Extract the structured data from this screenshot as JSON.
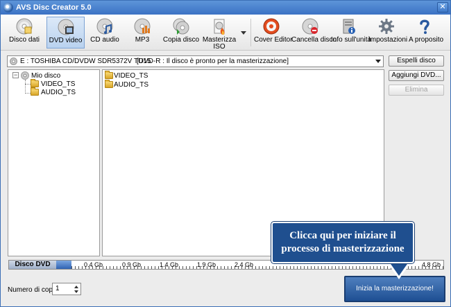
{
  "window": {
    "title": "AVS Disc Creator 5.0",
    "close_glyph": "✕"
  },
  "toolbar": {
    "items": [
      {
        "label": "Disco dati",
        "icon": "data-disc-icon"
      },
      {
        "label": "DVD video",
        "icon": "dvd-video-icon",
        "active": true
      },
      {
        "label": "CD audio",
        "icon": "audio-cd-icon"
      },
      {
        "label": "MP3",
        "icon": "mp3-disc-icon"
      },
      {
        "label": "Copia disco",
        "icon": "copy-disc-icon"
      },
      {
        "label": "Masterizza ISO",
        "icon": "burn-iso-icon"
      },
      {
        "label": "Cover Editor",
        "icon": "cover-editor-icon"
      },
      {
        "label": "Cancella disco",
        "icon": "erase-disc-icon"
      },
      {
        "label": "Info sull'unità",
        "icon": "drive-info-icon"
      },
      {
        "label": "Impostazioni",
        "icon": "settings-gear-icon"
      },
      {
        "label": "A proposito",
        "icon": "help-question-icon"
      }
    ]
  },
  "drive": {
    "name": "E : TOSHIBA  CD/DVDW SDR5372V TU15",
    "status": "[DVD-R : Il disco è pronto per la masterizzazione]"
  },
  "side_buttons": {
    "eject": "Espelli disco",
    "add_dvd": "Aggiungi DVD...",
    "delete": "Elimina"
  },
  "tree": {
    "root": "Mio disco",
    "expander": "−",
    "children": [
      "VIDEO_TS",
      "AUDIO_TS"
    ]
  },
  "files": [
    "VIDEO_TS",
    "AUDIO_TS"
  ],
  "capacity": {
    "label": "Disco DVD",
    "used_fraction": 0.04,
    "ticks": [
      "0.4 Gb",
      "0.9 Gb",
      "1.4 Gb",
      "1.9 Gb",
      "2.4 Gb",
      "4.8 Gb"
    ]
  },
  "copies": {
    "label": "Numero di copie:",
    "value": "1"
  },
  "start_button": "Inizia la masterizzazione!",
  "callout": {
    "line1": "Clicca qui per iniziare il",
    "line2": "processo di masterizzazione"
  },
  "colors": {
    "accent": "#1f4f8f",
    "titlebar": "#3b72c4"
  }
}
